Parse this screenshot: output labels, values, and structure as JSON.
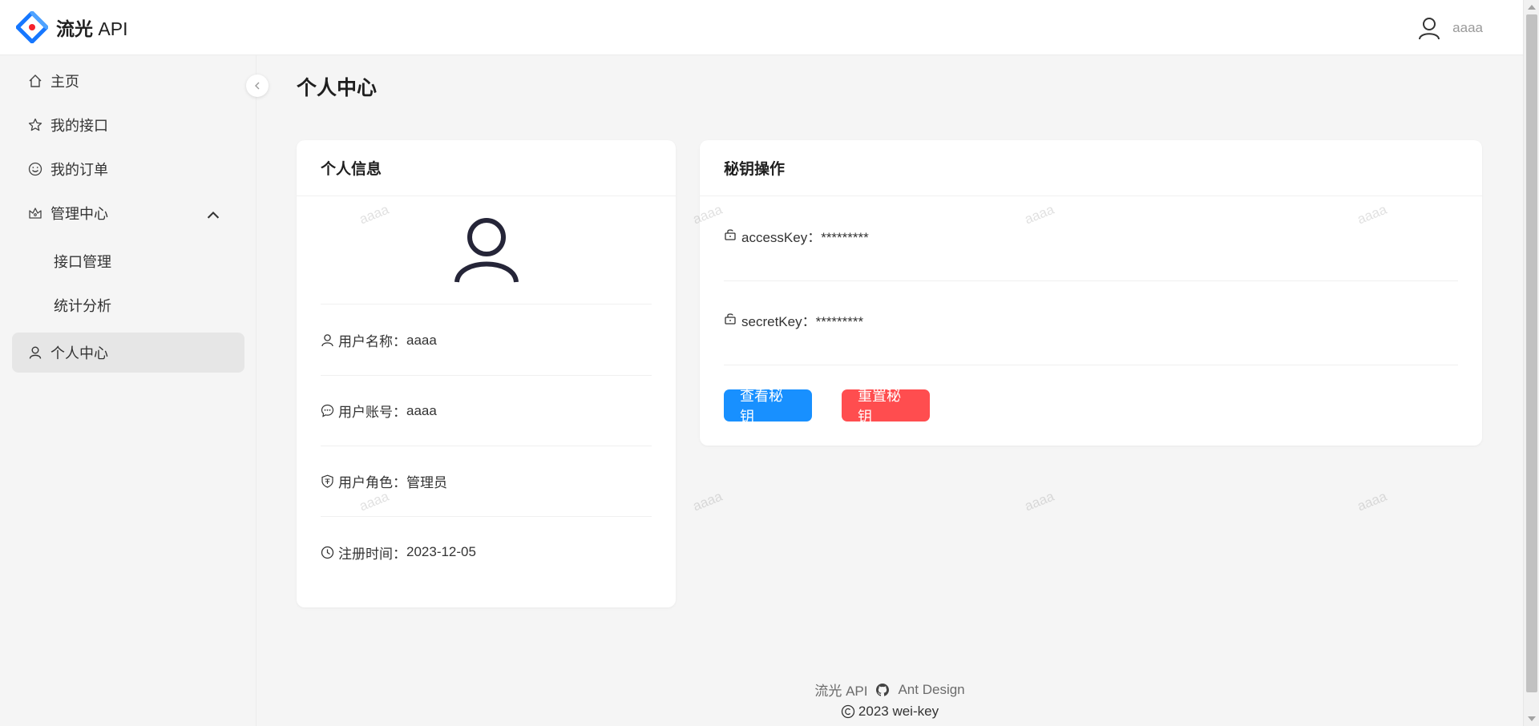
{
  "header": {
    "app_name_bold": "流光",
    "app_name_rest": "API",
    "user_name": "aaaa"
  },
  "sidebar": {
    "items": [
      {
        "label": "主页",
        "icon": "home-icon"
      },
      {
        "label": "我的接口",
        "icon": "star-icon"
      },
      {
        "label": "我的订单",
        "icon": "smile-icon"
      },
      {
        "label": "管理中心",
        "icon": "crown-icon",
        "expanded": true
      },
      {
        "label": "接口管理"
      },
      {
        "label": "统计分析"
      },
      {
        "label": "个人中心",
        "icon": "user-icon",
        "active": true
      }
    ]
  },
  "main": {
    "page_title": "个人中心",
    "info_card": {
      "title": "个人信息",
      "rows": [
        {
          "label": "用户名称：",
          "value": "aaaa"
        },
        {
          "label": "用户账号：",
          "value": "aaaa"
        },
        {
          "label": "用户角色：",
          "value": "管理员"
        },
        {
          "label": "注册时间：",
          "value": "2023-12-05"
        }
      ]
    },
    "key_card": {
      "title": "秘钥操作",
      "access_key": "accessKey：*********",
      "secret_key": "secretKey：*********",
      "view_button": "查看秘钥",
      "reset_button": "重置秘钥"
    },
    "watermark": "aaaa"
  },
  "footer": {
    "link1": "流光 API",
    "link2": "Ant Design",
    "copyright": "2023 wei-key"
  },
  "colors": {
    "primary": "#1890ff",
    "danger": "#ff4d4f",
    "logo_blue": "#1677ff",
    "logo_red": "#f5222d"
  }
}
